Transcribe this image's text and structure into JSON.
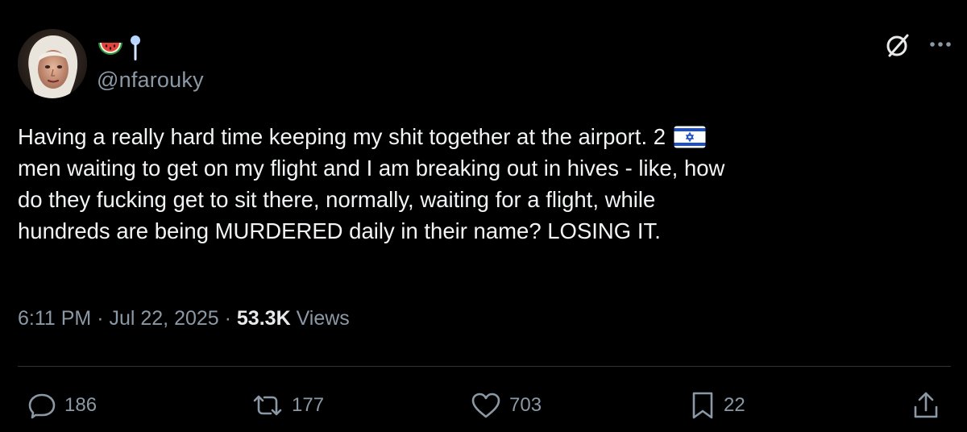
{
  "post": {
    "author": {
      "display_name_icons": [
        "watermelon-emoji",
        "pin-emoji"
      ],
      "handle": "@nfarouky"
    },
    "text_lines": [
      "Having a really hard time keeping my shit together at the airport. 2",
      "men waiting to get on my flight and I am breaking out in hives - like, how",
      "do they fucking get to sit there, normally, waiting for a flight, while",
      "hundreds are being MURDERED daily in their name? LOSING IT."
    ],
    "inline_emoji": "israel-flag-emoji",
    "timestamp": "6:11 PM · Jul 22, 2025 · ",
    "views_count": "53.3K",
    "views_label": " Views",
    "actions": {
      "replies": "186",
      "reposts": "177",
      "likes": "703",
      "bookmarks": "22"
    }
  },
  "colors": {
    "background": "#000000",
    "text": "#e7e9ea",
    "muted": "#8b98a5",
    "divider": "#2f3336"
  }
}
